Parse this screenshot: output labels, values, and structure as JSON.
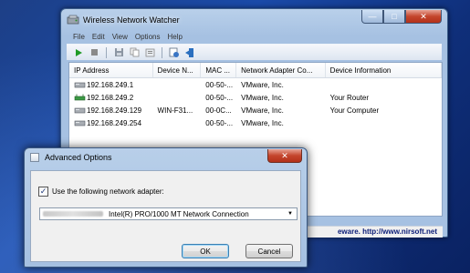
{
  "window": {
    "title": "Wireless Network Watcher",
    "icon": "network-watcher-icon"
  },
  "menu": [
    "File",
    "Edit",
    "View",
    "Options",
    "Help"
  ],
  "toolbar": {
    "icons": [
      "play-icon",
      "stop-icon",
      "save-icon",
      "copy-icon",
      "properties-icon",
      "refresh-icon",
      "exit-icon"
    ]
  },
  "table": {
    "columns": [
      "IP Address",
      "Device N...",
      "MAC ...",
      "Network Adapter Co...",
      "Device Information"
    ],
    "rows": [
      [
        "192.168.249.1",
        "",
        "00-50-...",
        "VMware, Inc.",
        ""
      ],
      [
        "192.168.249.2",
        "",
        "00-50-...",
        "VMware, Inc.",
        "Your Router"
      ],
      [
        "192.168.249.129",
        "WIN-F31...",
        "00-0C...",
        "VMware, Inc.",
        "Your Computer"
      ],
      [
        "192.168.249.254",
        "",
        "00-50-...",
        "VMware, Inc.",
        ""
      ]
    ]
  },
  "status": {
    "link": "eware.  http://www.nirsoft.net"
  },
  "dialog": {
    "title": "Advanced Options",
    "checkbox_label": "Use the following network adapter:",
    "checkbox_checked": true,
    "adapter": "Intel(R) PRO/1000 MT Network Connection",
    "ok": "OK",
    "cancel": "Cancel"
  },
  "colors": {
    "desktop": "#1a4aa8",
    "link": "#0b1c77",
    "close": "#c4452c"
  }
}
